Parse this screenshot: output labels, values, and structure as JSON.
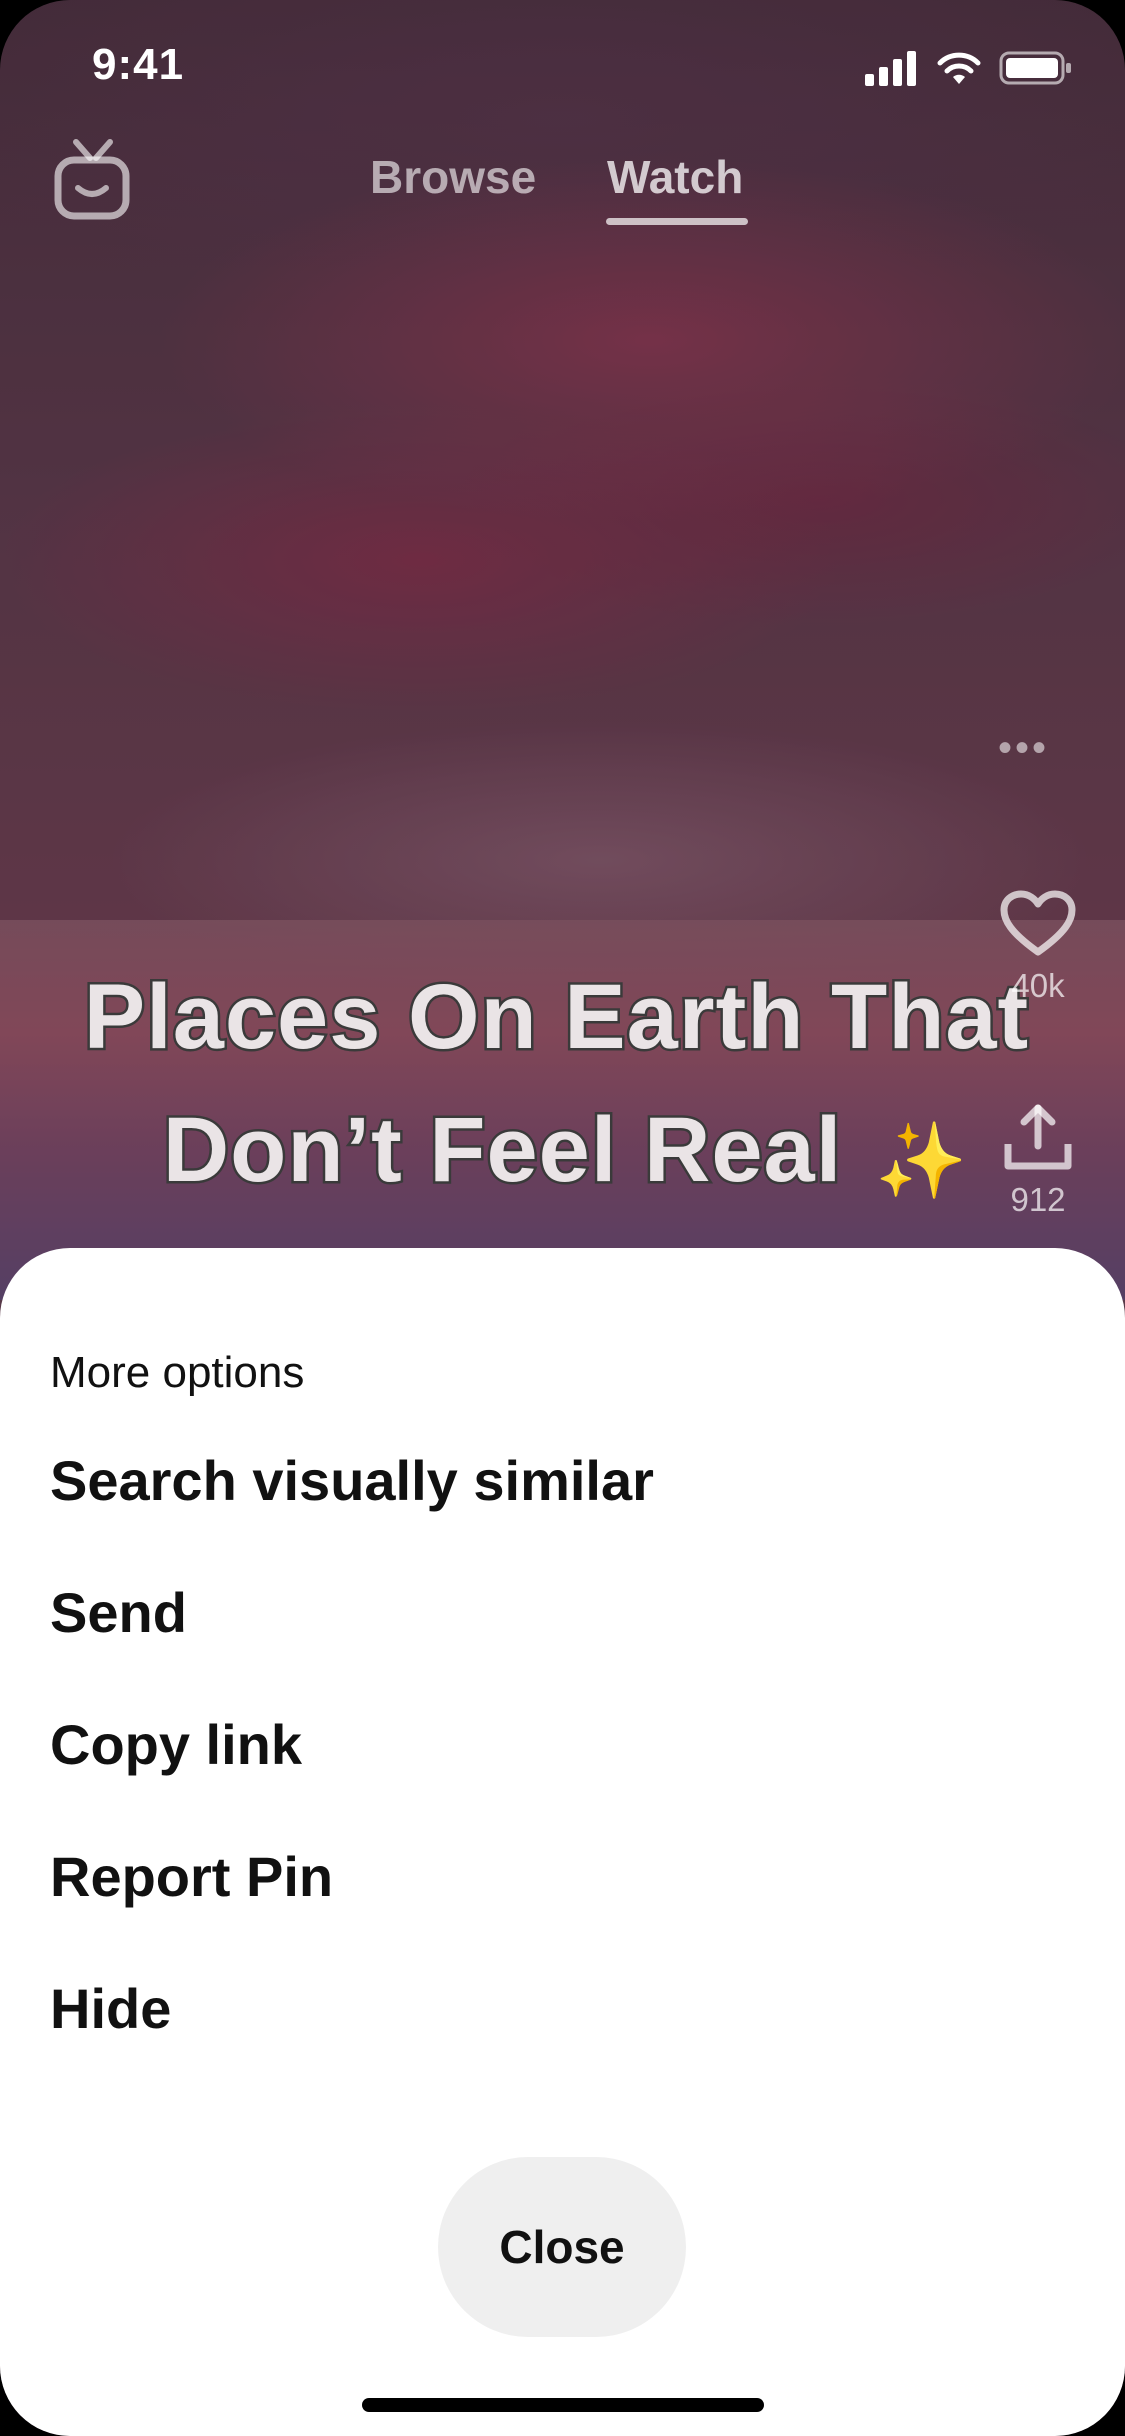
{
  "status_bar": {
    "time": "9:41"
  },
  "nav": {
    "tabs": [
      {
        "label": "Browse"
      },
      {
        "label": "Watch"
      }
    ],
    "active_tab": "Watch"
  },
  "video": {
    "caption_line1": "Places On Earth That",
    "caption_line2": "Don’t Feel Real",
    "caption_emoji": "✨",
    "likes": "40k",
    "shares": "912"
  },
  "sheet": {
    "title": "More options",
    "items": [
      {
        "label": "Search visually similar"
      },
      {
        "label": "Send"
      },
      {
        "label": "Copy link"
      },
      {
        "label": "Report Pin"
      },
      {
        "label": "Hide"
      }
    ],
    "close_label": "Close"
  },
  "icons": {
    "tv": "tv-icon",
    "heart": "heart-icon",
    "share": "share-icon",
    "more": "more-dots-icon"
  }
}
